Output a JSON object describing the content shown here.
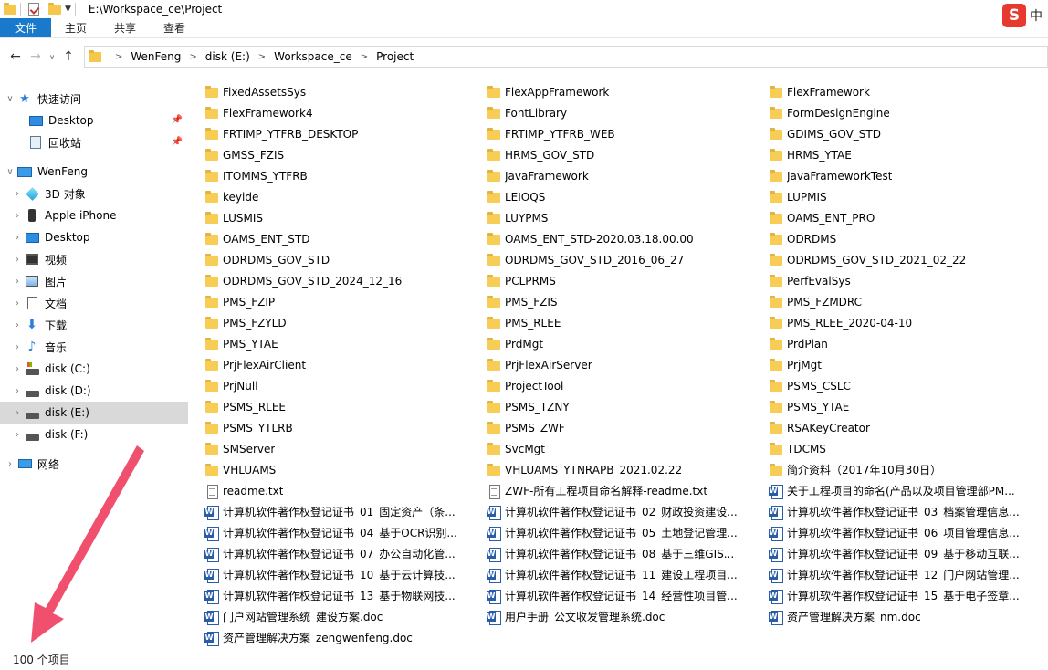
{
  "window": {
    "title_path": "E:\\Workspace_ce\\Project",
    "ime_logo": "S",
    "ime_mode": "中"
  },
  "ribbon": {
    "tabs": [
      "文件",
      "主页",
      "共享",
      "查看"
    ]
  },
  "address": {
    "crumbs": [
      "WenFeng",
      "disk (E:)",
      "Workspace_ce",
      "Project"
    ]
  },
  "sidebar": {
    "quick_access": "快速访问",
    "quick_items": [
      "Desktop",
      "回收站"
    ],
    "pc": "WenFeng",
    "pc_items": [
      "3D 对象",
      "Apple iPhone",
      "Desktop",
      "视频",
      "图片",
      "文档",
      "下载",
      "音乐",
      "disk (C:)",
      "disk (D:)",
      "disk (E:)",
      "disk (F:)"
    ],
    "network": "网络"
  },
  "files": [
    {
      "name": "FixedAssetsSys",
      "type": "folder"
    },
    {
      "name": "FlexAppFramework",
      "type": "folder"
    },
    {
      "name": "FlexFramework",
      "type": "folder"
    },
    {
      "name": "FlexFramework4",
      "type": "folder"
    },
    {
      "name": "FontLibrary",
      "type": "folder"
    },
    {
      "name": "FormDesignEngine",
      "type": "folder"
    },
    {
      "name": "FRTIMP_YTFRB_DESKTOP",
      "type": "folder"
    },
    {
      "name": "FRTIMP_YTFRB_WEB",
      "type": "folder"
    },
    {
      "name": "GDIMS_GOV_STD",
      "type": "folder"
    },
    {
      "name": "GMSS_FZIS",
      "type": "folder"
    },
    {
      "name": "HRMS_GOV_STD",
      "type": "folder"
    },
    {
      "name": "HRMS_YTAE",
      "type": "folder"
    },
    {
      "name": "ITOMMS_YTFRB",
      "type": "folder"
    },
    {
      "name": "JavaFramework",
      "type": "folder"
    },
    {
      "name": "JavaFrameworkTest",
      "type": "folder"
    },
    {
      "name": "keyide",
      "type": "folder"
    },
    {
      "name": "LEIOQS",
      "type": "folder"
    },
    {
      "name": "LUPMIS",
      "type": "folder"
    },
    {
      "name": "LUSMIS",
      "type": "folder"
    },
    {
      "name": "LUYPMS",
      "type": "folder"
    },
    {
      "name": "OAMS_ENT_PRO",
      "type": "folder"
    },
    {
      "name": "OAMS_ENT_STD",
      "type": "folder"
    },
    {
      "name": "OAMS_ENT_STD-2020.03.18.00.00",
      "type": "folder"
    },
    {
      "name": "ODRDMS",
      "type": "folder"
    },
    {
      "name": "ODRDMS_GOV_STD",
      "type": "folder"
    },
    {
      "name": "ODRDMS_GOV_STD_2016_06_27",
      "type": "folder"
    },
    {
      "name": "ODRDMS_GOV_STD_2021_02_22",
      "type": "folder"
    },
    {
      "name": "ODRDMS_GOV_STD_2024_12_16",
      "type": "folder"
    },
    {
      "name": "PCLPRMS",
      "type": "folder"
    },
    {
      "name": "PerfEvalSys",
      "type": "folder"
    },
    {
      "name": "PMS_FZIP",
      "type": "folder"
    },
    {
      "name": "PMS_FZIS",
      "type": "folder"
    },
    {
      "name": "PMS_FZMDRC",
      "type": "folder"
    },
    {
      "name": "PMS_FZYLD",
      "type": "folder"
    },
    {
      "name": "PMS_RLEE",
      "type": "folder"
    },
    {
      "name": "PMS_RLEE_2020-04-10",
      "type": "folder"
    },
    {
      "name": "PMS_YTAE",
      "type": "folder"
    },
    {
      "name": "PrdMgt",
      "type": "folder"
    },
    {
      "name": "PrdPlan",
      "type": "folder"
    },
    {
      "name": "PrjFlexAirClient",
      "type": "folder"
    },
    {
      "name": "PrjFlexAirServer",
      "type": "folder"
    },
    {
      "name": "PrjMgt",
      "type": "folder"
    },
    {
      "name": "PrjNull",
      "type": "folder"
    },
    {
      "name": "ProjectTool",
      "type": "folder"
    },
    {
      "name": "PSMS_CSLC",
      "type": "folder"
    },
    {
      "name": "PSMS_RLEE",
      "type": "folder"
    },
    {
      "name": "PSMS_TZNY",
      "type": "folder"
    },
    {
      "name": "PSMS_YTAE",
      "type": "folder"
    },
    {
      "name": "PSMS_YTLRB",
      "type": "folder"
    },
    {
      "name": "PSMS_ZWF",
      "type": "folder"
    },
    {
      "name": "RSAKeyCreator",
      "type": "folder"
    },
    {
      "name": "SMServer",
      "type": "folder"
    },
    {
      "name": "SvcMgt",
      "type": "folder"
    },
    {
      "name": "TDCMS",
      "type": "folder"
    },
    {
      "name": "VHLUAMS",
      "type": "folder"
    },
    {
      "name": "VHLUAMS_YTNRAPB_2021.02.22",
      "type": "folder"
    },
    {
      "name": "简介资料（2017年10月30日）",
      "type": "folder"
    },
    {
      "name": "readme.txt",
      "type": "txt"
    },
    {
      "name": "ZWF-所有工程项目命名解释-readme.txt",
      "type": "txt"
    },
    {
      "name": "关于工程项目的命名(产品以及项目管理部PM...",
      "type": "doc"
    },
    {
      "name": "计算机软件著作权登记证书_01_固定资产（条...",
      "type": "doc"
    },
    {
      "name": "计算机软件著作权登记证书_02_财政投资建设...",
      "type": "doc"
    },
    {
      "name": "计算机软件著作权登记证书_03_档案管理信息...",
      "type": "doc"
    },
    {
      "name": "计算机软件著作权登记证书_04_基于OCR识别...",
      "type": "doc"
    },
    {
      "name": "计算机软件著作权登记证书_05_土地登记管理...",
      "type": "doc"
    },
    {
      "name": "计算机软件著作权登记证书_06_项目管理信息...",
      "type": "doc"
    },
    {
      "name": "计算机软件著作权登记证书_07_办公自动化管...",
      "type": "doc"
    },
    {
      "name": "计算机软件著作权登记证书_08_基于三维GIS...",
      "type": "doc"
    },
    {
      "name": "计算机软件著作权登记证书_09_基于移动互联...",
      "type": "doc"
    },
    {
      "name": "计算机软件著作权登记证书_10_基于云计算技...",
      "type": "doc"
    },
    {
      "name": "计算机软件著作权登记证书_11_建设工程项目...",
      "type": "doc"
    },
    {
      "name": "计算机软件著作权登记证书_12_门户网站管理...",
      "type": "doc"
    },
    {
      "name": "计算机软件著作权登记证书_13_基于物联网技...",
      "type": "doc"
    },
    {
      "name": "计算机软件著作权登记证书_14_经营性项目管...",
      "type": "doc"
    },
    {
      "name": "计算机软件著作权登记证书_15_基于电子签章...",
      "type": "doc"
    },
    {
      "name": "门户网站管理系统_建设方案.doc",
      "type": "doc"
    },
    {
      "name": "用户手册_公文收发管理系统.doc",
      "type": "doc"
    },
    {
      "name": "资产管理解决方案_nm.doc",
      "type": "doc"
    },
    {
      "name": "资产管理解决方案_zengwenfeng.doc",
      "type": "doc"
    }
  ],
  "status": {
    "item_count": "100 个项目"
  },
  "colors": {
    "accent": "#1979ca",
    "folder": "#f7cd55",
    "selected": "#d9d9d9",
    "annotation_arrow": "#f0506e"
  }
}
